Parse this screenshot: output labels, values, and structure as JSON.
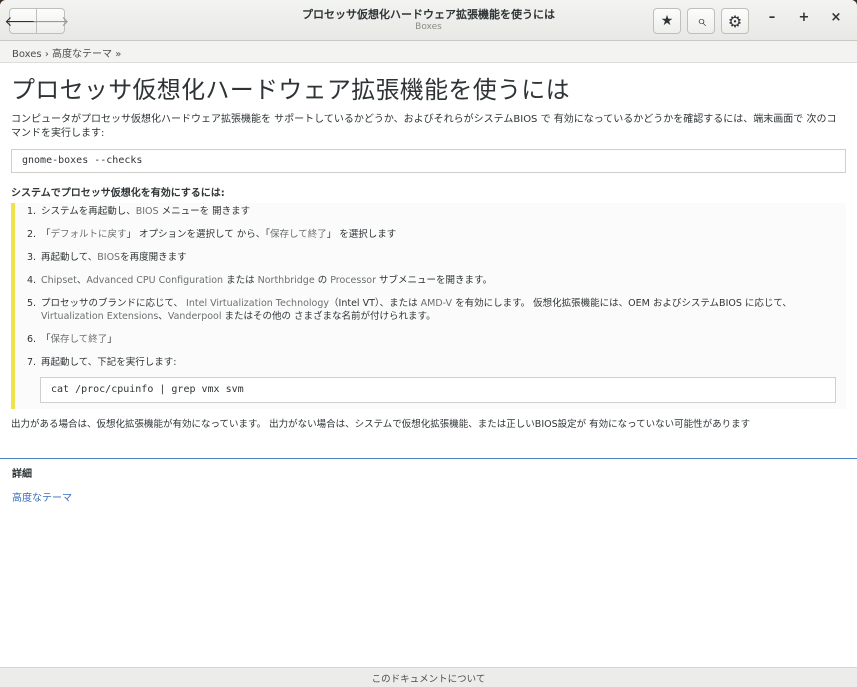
{
  "window": {
    "title": "プロセッサ仮想化ハードウェア拡張機能を使うには",
    "subtitle": "Boxes"
  },
  "icons": {
    "back": "arrow-left-icon",
    "forward": "arrow-right-icon",
    "bookmark": "star-icon",
    "search": "search-icon",
    "menu": "gear-icon",
    "minimize": "minimize-icon",
    "maximize": "maximize-icon",
    "close": "close-icon"
  },
  "glyphs": {
    "back": "🡐",
    "forward": "🡒",
    "bookmark": "★",
    "search": "⌕",
    "menu": "⚙",
    "minimize": "–",
    "maximize": "+",
    "close": "×"
  },
  "breadcrumb": {
    "root": "Boxes",
    "sep": " › ",
    "current": "高度なテーマ",
    "tail": " »"
  },
  "page": {
    "heading": "プロセッサ仮想化ハードウェア拡張機能を使うには",
    "intro": "コンピュータがプロセッサ仮想化ハードウェア拡張機能を サポートしているかどうか、およびそれらがシステムBIOS で 有効になっているかどうかを確認するには、端末画面で 次のコマンドを実行します:",
    "command": "gnome-boxes --checks",
    "steps_heading": "システムでプロセッサ仮想化を有効にするには:",
    "steps": [
      {
        "num": "1.",
        "a": "システムを再起動し、",
        "b": "BIOS",
        "c": " メニューを 開きます"
      },
      {
        "num": "2.",
        "a": "「",
        "b": "デフォルトに戻す",
        "c": "」 オプションを選択して から、「",
        "d": "保存して終了",
        "e": "」 を選択します"
      },
      {
        "num": "3.",
        "a": "再起動して、",
        "b": "BIOS",
        "c": "を再度開きます"
      },
      {
        "num": "4.",
        "a": "",
        "b": "Chipset",
        "c": "、",
        "d": "Advanced CPU Configuration",
        "e": " または ",
        "f": "Northbridge",
        "g": " の ",
        "h": "Processor",
        "i": " サブメニューを開きます。"
      },
      {
        "num": "5.",
        "a": "プロセッサのブランドに応じて、 ",
        "b": "Intel Virtualization Technology",
        "c": "（Intel VT）、または ",
        "d": "AMD-V",
        "e": " を有効にします。 仮想化拡張機能には、OEM およびシステムBIOS に応じて、",
        "f": "Virtualization Extensions",
        "g": "、",
        "h": "Vanderpool",
        "i": " またはその他の さまざまな名前が付けられます。"
      },
      {
        "num": "6.",
        "a": "「",
        "b": "保存して終了",
        "c": "」"
      },
      {
        "num": "7.",
        "a": "再起動して、下記を実行します:"
      }
    ],
    "command2": "cat /proc/cpuinfo | grep vmx svm",
    "outro": "出力がある場合は、仮想化拡張機能が有効になっています。 出力がない場合は、システムで仮想化拡張機能、または正しいBIOS設定が 有効になっていない可能性があります"
  },
  "more": {
    "title": "詳細",
    "link": "高度なテーマ"
  },
  "footer": {
    "label": "このドキュメントについて"
  }
}
